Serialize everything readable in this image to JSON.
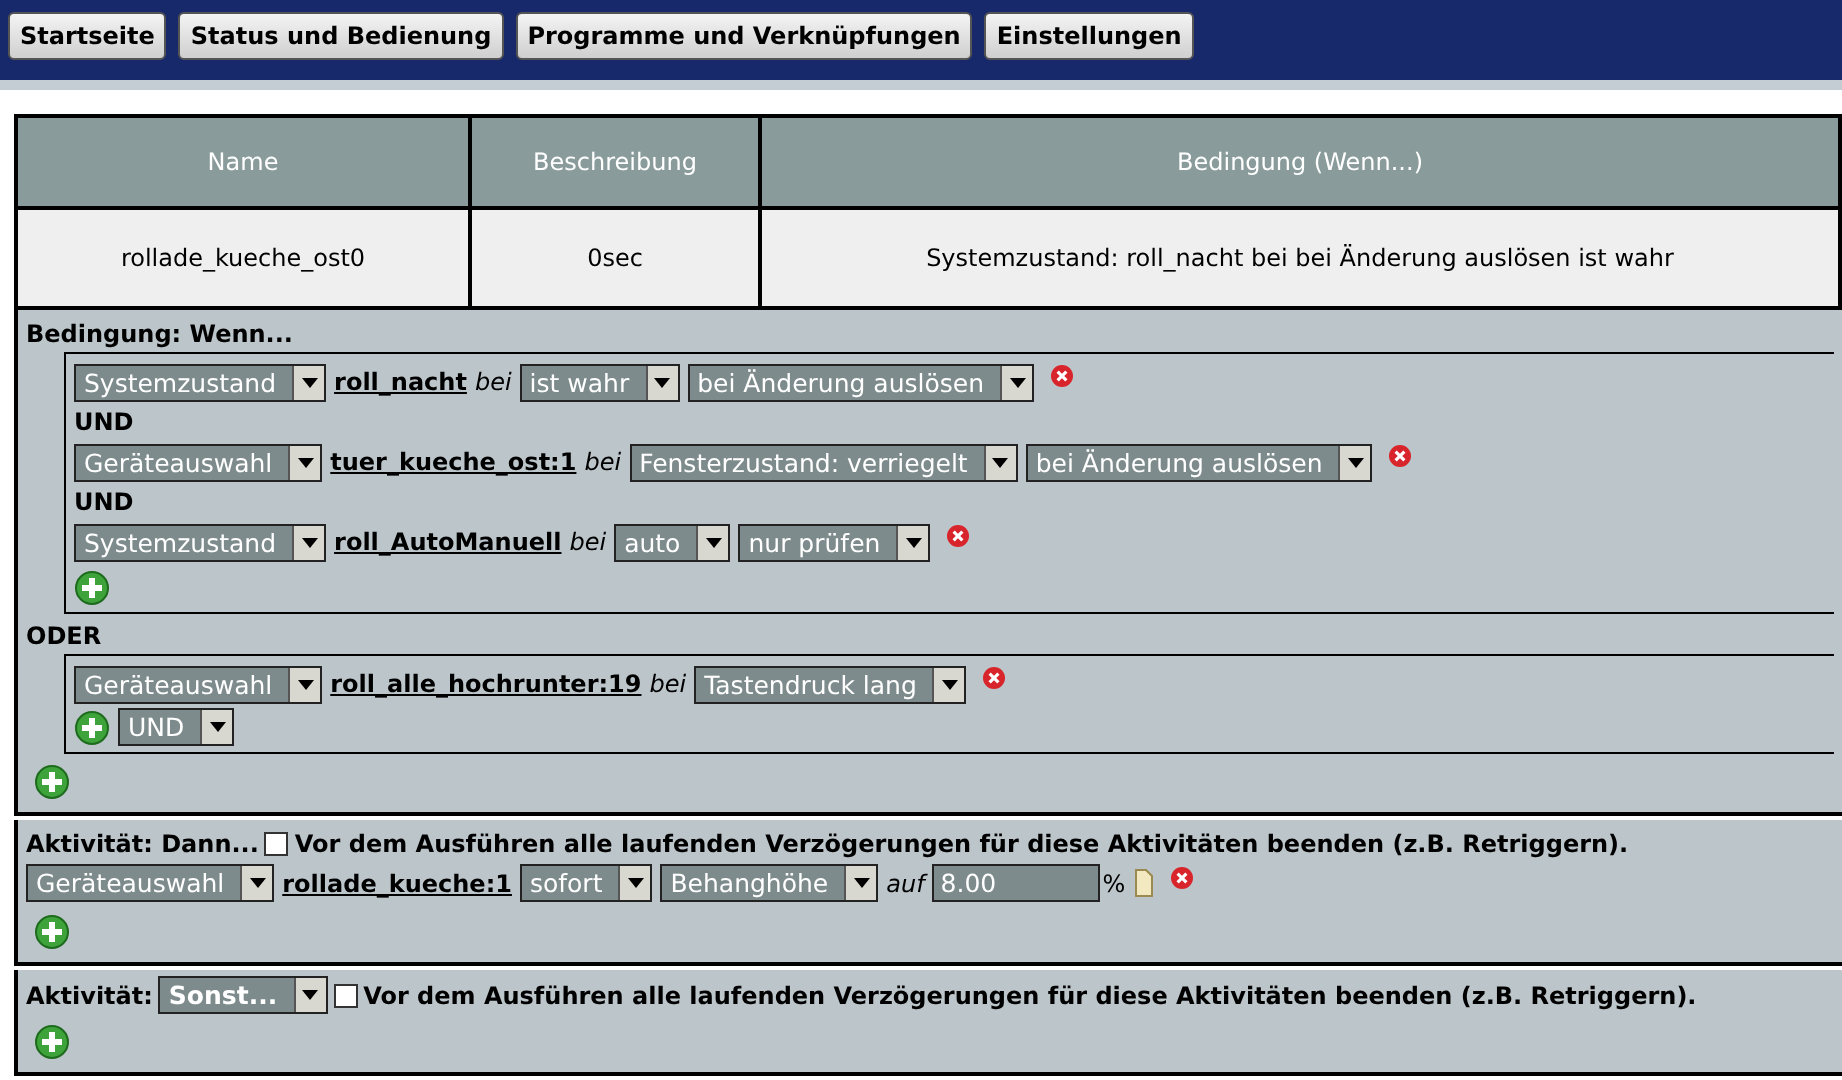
{
  "nav": [
    {
      "label": "Startseite"
    },
    {
      "label": "Status und Bedienung"
    },
    {
      "label": "Programme und Verknüpfungen"
    },
    {
      "label": "Einstellungen"
    }
  ],
  "table": {
    "columns": [
      "Name",
      "Beschreibung",
      "Bedingung (Wenn...)"
    ],
    "rows": [
      [
        "rollade_kueche_ost0",
        "0sec",
        "Systemzustand: roll_nacht bei bei Änderung auslösen ist wahr"
      ]
    ]
  },
  "condition": {
    "title": "Bedingung: Wenn...",
    "groups": [
      {
        "lines": [
          {
            "parts": [
              {
                "kind": "select",
                "text": "Systemzustand"
              },
              {
                "kind": "link",
                "text": "roll_nacht"
              },
              {
                "kind": "word",
                "text": "bei"
              },
              {
                "kind": "select",
                "text": "ist wahr"
              },
              {
                "kind": "select",
                "text": "bei Änderung auslösen"
              },
              {
                "kind": "remove"
              }
            ]
          },
          {
            "joiner": "UND",
            "parts": [
              {
                "kind": "select",
                "text": "Geräteauswahl"
              },
              {
                "kind": "link",
                "text": "tuer_kueche_ost:1"
              },
              {
                "kind": "word",
                "text": "bei"
              },
              {
                "kind": "select",
                "text": "Fensterzustand: verriegelt"
              },
              {
                "kind": "select",
                "text": "bei Änderung auslösen"
              },
              {
                "kind": "remove"
              }
            ]
          },
          {
            "joiner": "UND",
            "parts": [
              {
                "kind": "select",
                "text": "Systemzustand"
              },
              {
                "kind": "link",
                "text": "roll_AutoManuell"
              },
              {
                "kind": "word",
                "text": "bei"
              },
              {
                "kind": "select",
                "text": "auto"
              },
              {
                "kind": "select",
                "text": "nur prüfen"
              },
              {
                "kind": "remove"
              }
            ]
          }
        ]
      },
      {
        "label": "ODER",
        "lines": [
          {
            "parts": [
              {
                "kind": "select",
                "text": "Geräteauswahl"
              },
              {
                "kind": "link",
                "text": "roll_alle_hochrunter:19"
              },
              {
                "kind": "word",
                "text": "bei"
              },
              {
                "kind": "select",
                "text": "Tastendruck lang"
              },
              {
                "kind": "remove"
              }
            ]
          }
        ],
        "footer_select": "UND"
      }
    ]
  },
  "activities": [
    {
      "title": "Aktivität: Dann...",
      "checked": false,
      "option": "Vor dem Ausführen alle laufenden Verzögerungen für diese Aktivitäten beenden (z.B. Retriggern).",
      "lines": [
        {
          "parts": [
            {
              "kind": "select",
              "text": "Geräteauswahl"
            },
            {
              "kind": "link",
              "text": "rollade_kueche:1"
            },
            {
              "kind": "select",
              "text": "sofort"
            },
            {
              "kind": "select",
              "text": "Behanghöhe"
            },
            {
              "kind": "word",
              "text": "auf"
            },
            {
              "kind": "input",
              "text": "8.00"
            },
            {
              "kind": "unit",
              "text": "%"
            },
            {
              "kind": "doc"
            },
            {
              "kind": "remove"
            }
          ]
        }
      ]
    },
    {
      "title": "Aktivität:",
      "title_select": "Sonst...",
      "checked": false,
      "option": "Vor dem Ausführen alle laufenden Verzögerungen für diese Aktivitäten beenden (z.B. Retriggern)."
    }
  ]
}
